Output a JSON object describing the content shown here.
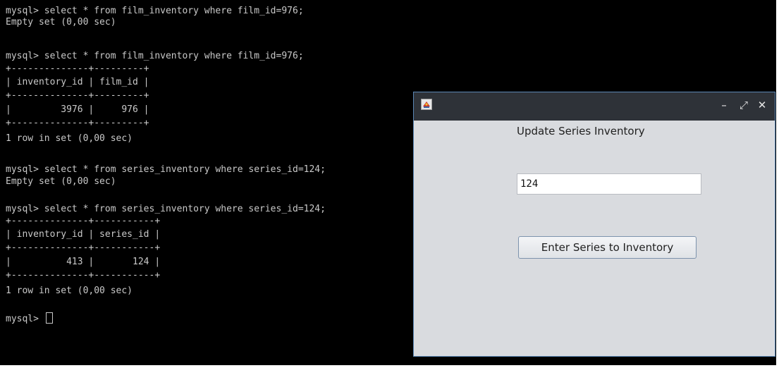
{
  "terminal": {
    "lines": [
      "mysql> select * from film_inventory where film_id=976;",
      "Empty set (0,00 sec)",
      "",
      "mysql> select * from film_inventory where film_id=976;",
      "+--------------+---------+",
      "| inventory_id | film_id |",
      "+--------------+---------+",
      "|         3976 |     976 |",
      "+--------------+---------+",
      "1 row in set (0,00 sec)",
      "",
      "mysql> select * from series_inventory where series_id=124;",
      "Empty set (0,00 sec)",
      "",
      "mysql> select * from series_inventory where series_id=124;",
      "+--------------+-----------+",
      "| inventory_id | series_id |",
      "+--------------+-----------+",
      "|          413 |       124 |",
      "+--------------+-----------+",
      "1 row in set (0,00 sec)",
      "",
      "mysql> "
    ]
  },
  "window": {
    "title": "",
    "controls": {
      "minimize": "–",
      "maximize": "⤢",
      "close": "✕"
    },
    "label": "Update Series Inventory",
    "input_value": "124",
    "button_label": "Enter Series to Inventory",
    "icons": {
      "app": "java-app-icon"
    }
  }
}
